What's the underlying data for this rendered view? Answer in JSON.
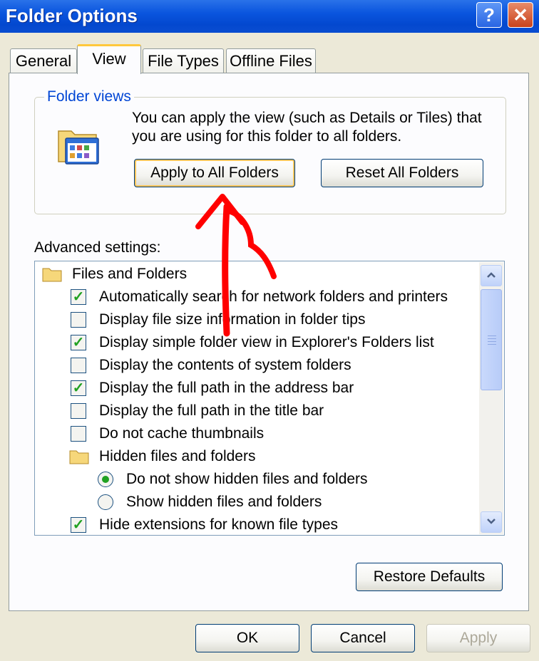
{
  "window": {
    "title": "Folder Options",
    "help": "?",
    "close": "✕"
  },
  "tabs": [
    {
      "label": "General",
      "active": false
    },
    {
      "label": "View",
      "active": true
    },
    {
      "label": "File Types",
      "active": false
    },
    {
      "label": "Offline Files",
      "active": false
    }
  ],
  "folder_views": {
    "label": "Folder views",
    "description": "You can apply the view (such as Details or Tiles) that you are using for this folder to all folders.",
    "icon": "folder-window-icon",
    "apply_button": "Apply to All Folders",
    "reset_button": "Reset All Folders"
  },
  "advanced": {
    "label": "Advanced settings:",
    "items": [
      {
        "type": "group",
        "icon": "folder-icon",
        "text": "Files and Folders"
      },
      {
        "type": "check",
        "checked": true,
        "text": "Automatically search for network folders and printers"
      },
      {
        "type": "check",
        "checked": false,
        "text": "Display file size information in folder tips"
      },
      {
        "type": "check",
        "checked": true,
        "text": "Display simple folder view in Explorer's Folders list"
      },
      {
        "type": "check",
        "checked": false,
        "text": "Display the contents of system folders"
      },
      {
        "type": "check",
        "checked": true,
        "text": "Display the full path in the address bar"
      },
      {
        "type": "check",
        "checked": false,
        "text": "Display the full path in the title bar"
      },
      {
        "type": "check",
        "checked": false,
        "text": "Do not cache thumbnails"
      },
      {
        "type": "subgroup",
        "icon": "folder-icon",
        "text": "Hidden files and folders"
      },
      {
        "type": "radio",
        "selected": true,
        "text": "Do not show hidden files and folders"
      },
      {
        "type": "radio",
        "selected": false,
        "text": "Show hidden files and folders"
      },
      {
        "type": "check",
        "checked": true,
        "text": "Hide extensions for known file types"
      }
    ],
    "restore_button": "Restore Defaults"
  },
  "footer": {
    "ok": "OK",
    "cancel": "Cancel",
    "apply": "Apply"
  },
  "colors": {
    "titlebar": "#0A55DE",
    "face": "#ECE9D8",
    "annotation_arrow": "#FF0000",
    "check": "#21A121",
    "group_label": "#0046D5"
  }
}
